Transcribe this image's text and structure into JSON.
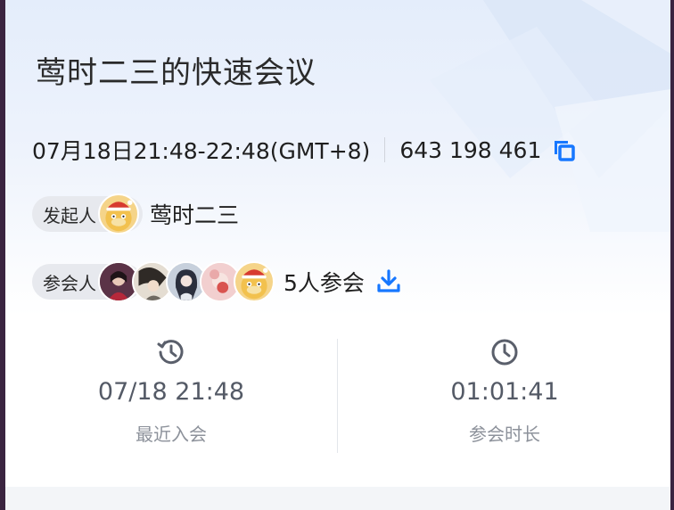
{
  "meeting": {
    "title": "莺时二三的快速会议",
    "time_range": "07月18日21:48-22:48(GMT+8)",
    "meeting_id": "643 198 461"
  },
  "host": {
    "label": "发起人",
    "name": "莺时二三"
  },
  "participants": {
    "label": "参会人",
    "count_text": "5人参会"
  },
  "stats": {
    "last_join": {
      "value": "07/18 21:48",
      "label": "最近入会"
    },
    "duration": {
      "value": "01:01:41",
      "label": "参会时长"
    }
  },
  "icons": {
    "copy": "copy-icon",
    "download": "download-icon",
    "history": "history-clock-icon",
    "clock": "clock-icon"
  },
  "colors": {
    "accent": "#1677ff",
    "text_primary": "#1f1f1f",
    "text_secondary": "#8d929b"
  }
}
